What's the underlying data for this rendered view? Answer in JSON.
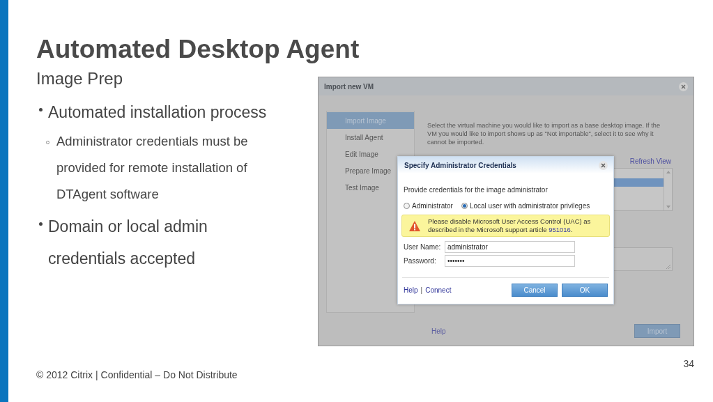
{
  "slide": {
    "title": "Automated Desktop Agent",
    "subtitle": "Image Prep",
    "bullets": [
      {
        "text": "Automated installation process",
        "children": [
          {
            "text": "Administrator credentials must be provided for remote installation of DTAgent software"
          }
        ]
      },
      {
        "text": "Domain or local admin credentials accepted"
      }
    ],
    "footer": "© 2012 Citrix | Confidential – Do Not Distribute",
    "page_number": "34"
  },
  "window": {
    "title": "Import new VM",
    "steps": [
      {
        "label": "Import Image",
        "selected": true
      },
      {
        "label": "Install Agent",
        "selected": false
      },
      {
        "label": "Edit Image",
        "selected": false
      },
      {
        "label": "Prepare Image",
        "selected": false
      },
      {
        "label": "Test Image",
        "selected": false
      }
    ],
    "instructions": "Select the virtual machine you would like to import as a base desktop image. If the VM you would like to import shows up as \"Not importable\", select it to see why it cannot be imported.",
    "refresh_link": "Refresh View",
    "vm_rows": [
      {
        "selected": false
      },
      {
        "selected": true
      },
      {
        "selected": false
      },
      {
        "selected": false
      }
    ],
    "help_link": "Help",
    "import_button": "Import"
  },
  "dialog": {
    "title": "Specify Administrator Credentials",
    "prompt": "Provide credentials for the image administrator",
    "account_types": [
      {
        "label": "Administrator",
        "selected": false
      },
      {
        "label": "Local user with administrator privileges",
        "selected": true
      }
    ],
    "warning": {
      "text": "Please disable Microsoft User Access Control (UAC) as described in the Microsoft support article ",
      "link": "951016",
      "end": "."
    },
    "fields": [
      {
        "label": "User Name:",
        "value": "administrator"
      },
      {
        "label": "Password:",
        "value": "•••••••"
      }
    ],
    "links": [
      "Help",
      "Connect"
    ],
    "link_separator": "|",
    "buttons": [
      "Cancel",
      "OK"
    ]
  }
}
